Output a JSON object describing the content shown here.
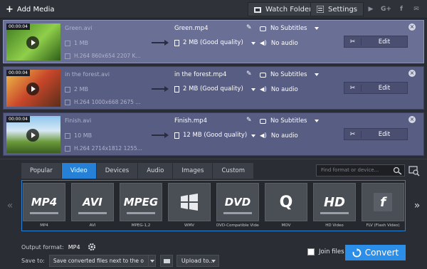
{
  "toolbar": {
    "add_media": "Add Media",
    "watch_folder": "Watch Folder",
    "settings": "Settings",
    "social": [
      "▶",
      "G+",
      "f",
      "✉"
    ]
  },
  "files": [
    {
      "duration": "00:00:04",
      "name": "Green.avi",
      "size": "1 MB",
      "codec": "H.264 860x654 2207 K...",
      "output_name": "Green.mp4",
      "output_size": "2 MB (Good quality)",
      "subtitles": "No Subtitles",
      "audio": "No audio",
      "edit": "Edit",
      "selected": true
    },
    {
      "duration": "00:00:04",
      "name": "in the forest.avi",
      "size": "2 MB",
      "codec": "H.264 1000x668 2675 ...",
      "output_name": "in the forest.mp4",
      "output_size": "2 MB (Good quality)",
      "subtitles": "No Subtitles",
      "audio": "No audio",
      "edit": "Edit",
      "selected": false
    },
    {
      "duration": "00:00:04",
      "name": "Finish.avi",
      "size": "10 MB",
      "codec": "H.264 2714x1812 1255...",
      "output_name": "Finish.mp4",
      "output_size": "12 MB (Good quality)",
      "subtitles": "No Subtitles",
      "audio": "No audio",
      "edit": "Edit",
      "selected": false
    }
  ],
  "tabs": [
    "Popular",
    "Video",
    "Devices",
    "Audio",
    "Images",
    "Custom"
  ],
  "active_tab": "Video",
  "search_placeholder": "Find format or device...",
  "formats": [
    {
      "label": "MP4",
      "caption": "MP4"
    },
    {
      "label": "AVI",
      "caption": "AVI"
    },
    {
      "label": "MPEG",
      "caption": "MPEG-1,2"
    },
    {
      "label": "",
      "caption": "WMV"
    },
    {
      "label": "DVD",
      "caption": "DVD-Compatible Video"
    },
    {
      "label": "Q",
      "caption": "MOV"
    },
    {
      "label": "HD",
      "caption": "HD Video"
    },
    {
      "label": "f",
      "caption": "FLV (Flash Video)"
    }
  ],
  "nav": {
    "prev": "«",
    "next": "»"
  },
  "output": {
    "format_label": "Output format:",
    "format_value": "MP4",
    "save_label": "Save to:",
    "save_value": "Save converted files next to the o",
    "upload": "Upload to...",
    "join": "Join files",
    "convert": "Convert"
  },
  "colors": {
    "accent": "#2b8ee8",
    "file_bg": "#585d83"
  }
}
